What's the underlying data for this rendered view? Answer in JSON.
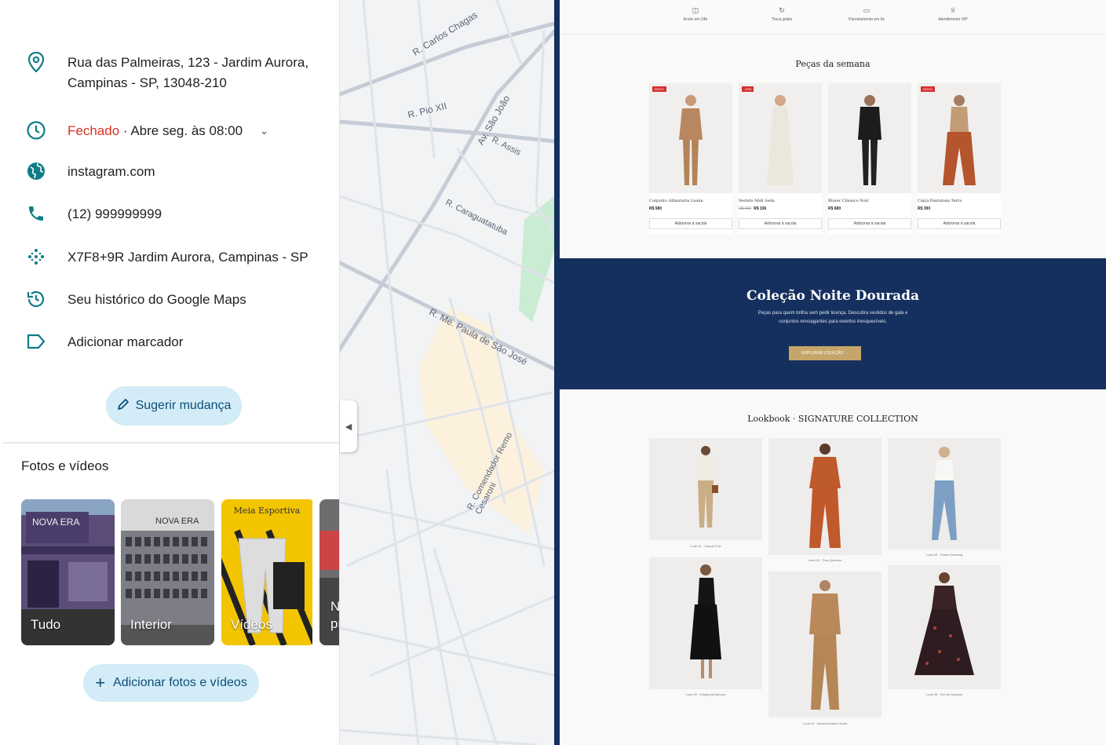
{
  "place": {
    "address": "Rua das Palmeiras, 123 - Jardim Aurora,",
    "address_line2": "Campinas - SP, 13048-210",
    "hours_status": "Fechado",
    "hours_detail": " · Abre seg. às 08:00",
    "website": "instagram.com",
    "phone": "(12) 999999999",
    "plus_code": "X7F8+9R Jardim Aurora, Campinas - SP",
    "history": "Seu histórico do Google Maps",
    "add_label": "Adicionar marcador",
    "suggest_label": "Sugerir mudança"
  },
  "photos": {
    "title": "Fotos e vídeos",
    "tiles": [
      {
        "label": "Tudo",
        "sign": "NOVA ERA"
      },
      {
        "label": "Interior",
        "sign": "NOVA ERA"
      },
      {
        "label": "Vídeos",
        "sign": "Meia Esportiva"
      }
    ],
    "partial_label": "N pr",
    "add_label": "Adicionar fotos e vídeos"
  },
  "map": {
    "streets": [
      "R. Carlos Chagas",
      "R. Pio XII",
      "Av. São João",
      "R. Assis",
      "R. Caraguatatuba",
      "R. Me. Paula de São José",
      "R. Comendador Remo Cesaroni"
    ]
  },
  "site": {
    "features": [
      "Envio em 24h",
      "Troca grátis",
      "Parcelamento em 6x",
      "Atendimento VIP"
    ],
    "week_title": "Peças da semana",
    "products": [
      {
        "badge": "NOVO",
        "name": "Conjunto Alfaiataria Luana",
        "old": "",
        "price": "R$ 580",
        "add": "Adicionar à sacola"
      },
      {
        "badge": "-20%",
        "name": "Vestido Midi Seda",
        "old": "R$ 420",
        "price": "R$ 336",
        "add": "Adicionar à sacola"
      },
      {
        "badge": "",
        "name": "Blazer Clássico Noir",
        "old": "",
        "price": "R$ 680",
        "add": "Adicionar à sacola"
      },
      {
        "badge": "NOVO",
        "name": "Calça Pantalona Terra",
        "old": "",
        "price": "R$ 390",
        "add": "Adicionar à sacola"
      }
    ],
    "banner": {
      "title": "Coleção Noite Dourada",
      "text": "Peças para quem brilha sem pedir licença. Descubra vestidos de gala e conjuntos envoagantes para eventos inesquecíveis.",
      "button": "EXPLORAR COLEÇÃO →"
    },
    "lookbook_title": "Lookbook · SIGNATURE COLLECTION",
    "looks": [
      "Look 01 · Casual Chic",
      "Look 03 · Tons Quentes",
      "Look 05 · Power Dressing",
      "Look 02 · Elegância Noturna",
      "Look 04 · Monocromático Nude",
      "Look 06 · Fim de Semana"
    ]
  },
  "colors": {
    "closed": "#d93025",
    "chip_bg": "#d3ecf7",
    "chip_text": "#0b4f7a",
    "icon_teal": "#0e7c86",
    "navy": "#15305e",
    "gold": "#c5a56a"
  }
}
